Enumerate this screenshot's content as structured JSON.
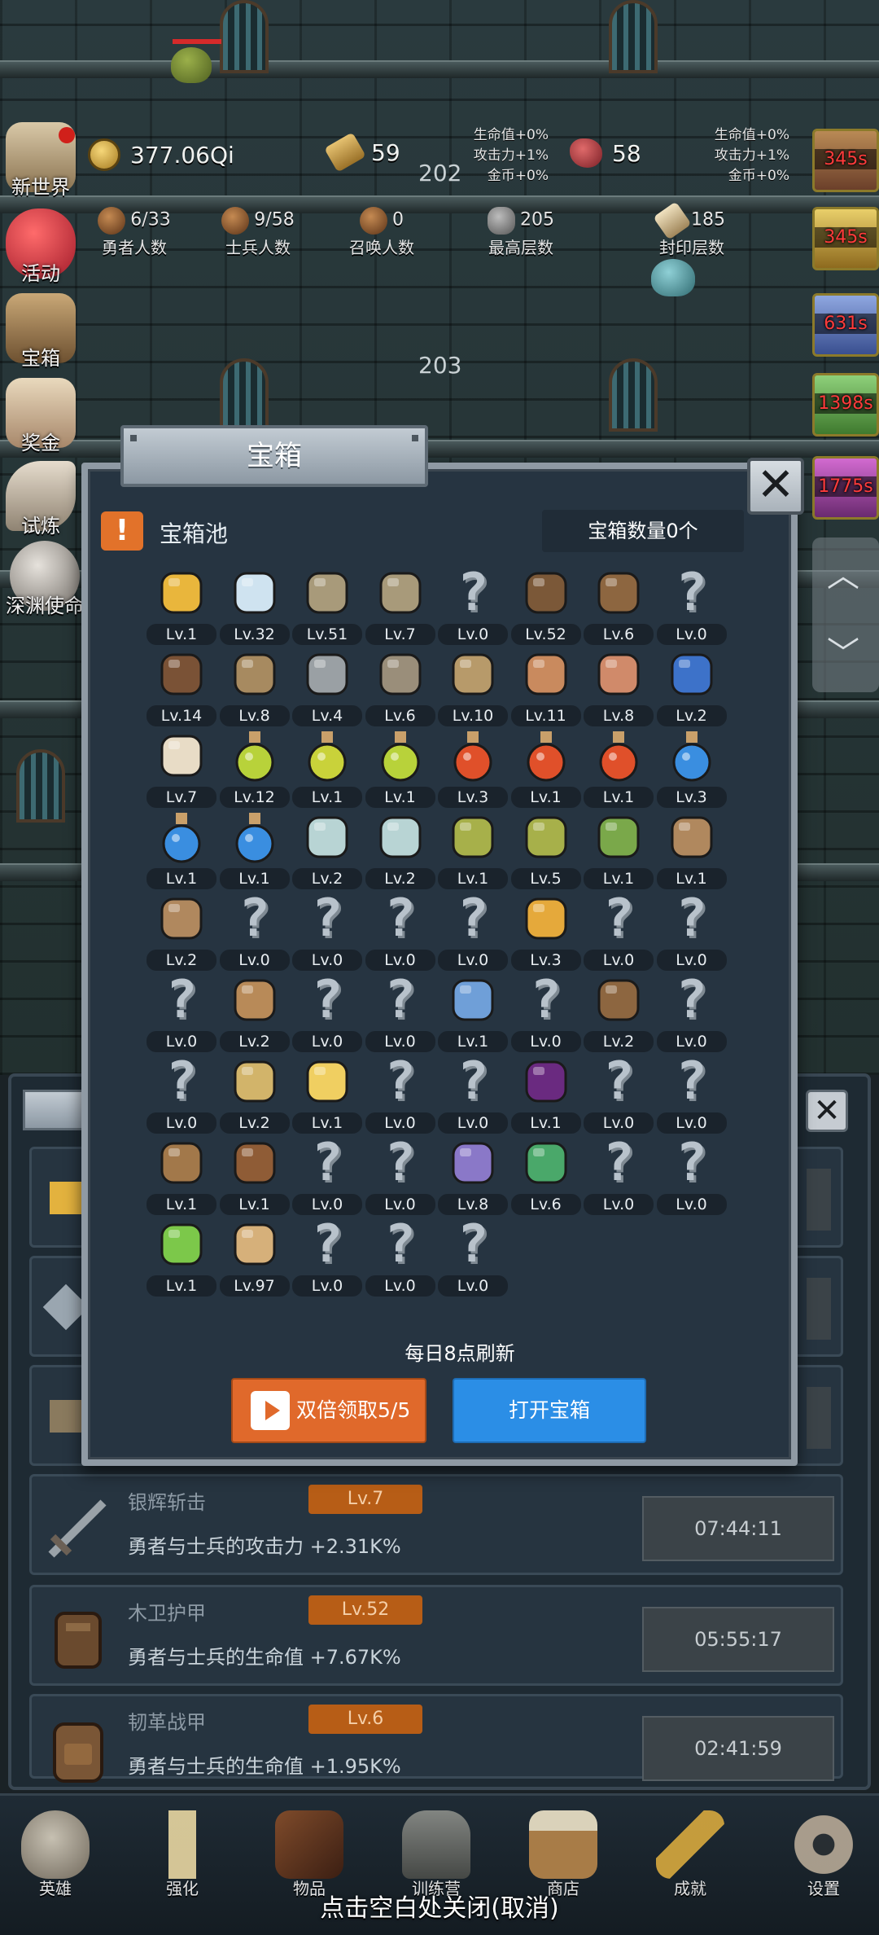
{
  "hud": {
    "gold": "377.06Qi",
    "scrolls": "59",
    "gems": "58",
    "bonus_left": [
      "生命值+0%",
      "攻击力+1%",
      "金币+0%"
    ],
    "bonus_right": [
      "生命值+0%",
      "攻击力+1%",
      "金币+0%"
    ],
    "floor_a": "202",
    "floor_b": "203",
    "stats": [
      {
        "value": "6/33",
        "label": "勇者人数"
      },
      {
        "value": "9/58",
        "label": "士兵人数"
      },
      {
        "value": "0",
        "label": "召唤人数"
      },
      {
        "value": "205",
        "label": "最高层数"
      },
      {
        "value": "185",
        "label": "封印层数"
      }
    ]
  },
  "side_menu": [
    {
      "label": "新世界",
      "icon": "map-icon"
    },
    {
      "label": "活动",
      "icon": "heart-icon"
    },
    {
      "label": "宝箱",
      "icon": "chest-icon"
    },
    {
      "label": "奖金",
      "icon": "envelope-icon"
    },
    {
      "label": "试炼",
      "icon": "wing-icon"
    },
    {
      "label": "深渊使命",
      "icon": "orb-icon"
    }
  ],
  "timers": [
    "345s",
    "345s",
    "631s",
    "1398s",
    "1775s"
  ],
  "modal": {
    "title": "宝箱",
    "pool_title": "宝箱池",
    "chest_count": "宝箱数量0个",
    "refresh_text": "每日8点刷新",
    "double_button": "双倍领取5/5",
    "open_button": "打开宝箱",
    "items": [
      {
        "icon": "crown-icon",
        "level": "Lv.1"
      },
      {
        "icon": "diamond-icon",
        "level": "Lv.32"
      },
      {
        "icon": "sword-icon",
        "level": "Lv.51"
      },
      {
        "icon": "sword-icon",
        "level": "Lv.7"
      },
      {
        "icon": "unknown-icon",
        "level": "Lv.0"
      },
      {
        "icon": "armor-icon",
        "level": "Lv.52"
      },
      {
        "icon": "backpack-icon",
        "level": "Lv.6"
      },
      {
        "icon": "unknown-icon",
        "level": "Lv.0"
      },
      {
        "icon": "helmet-icon",
        "level": "Lv.14"
      },
      {
        "icon": "dagger-icon",
        "level": "Lv.8"
      },
      {
        "icon": "knight-helmet-icon",
        "level": "Lv.4"
      },
      {
        "icon": "hammer-icon",
        "level": "Lv.6"
      },
      {
        "icon": "great-helm-icon",
        "level": "Lv.10"
      },
      {
        "icon": "ham-icon",
        "level": "Lv.11"
      },
      {
        "icon": "steak-icon",
        "level": "Lv.8"
      },
      {
        "icon": "pouch-icon",
        "level": "Lv.2"
      },
      {
        "icon": "flour-icon",
        "level": "Lv.7"
      },
      {
        "icon": "potion-icon",
        "level": "Lv.12"
      },
      {
        "icon": "potion-icon",
        "level": "Lv.1"
      },
      {
        "icon": "potion-icon",
        "level": "Lv.1"
      },
      {
        "icon": "potion-icon",
        "level": "Lv.3"
      },
      {
        "icon": "potion-icon",
        "level": "Lv.1"
      },
      {
        "icon": "potion-icon",
        "level": "Lv.1"
      },
      {
        "icon": "potion-icon",
        "level": "Lv.3"
      },
      {
        "icon": "potion-icon",
        "level": "Lv.1"
      },
      {
        "icon": "potion-icon",
        "level": "Lv.1"
      },
      {
        "icon": "vial-icon",
        "level": "Lv.2"
      },
      {
        "icon": "vial-icon",
        "level": "Lv.2"
      },
      {
        "icon": "bottle-icon",
        "level": "Lv.1"
      },
      {
        "icon": "bottle-icon",
        "level": "Lv.5"
      },
      {
        "icon": "winged-boot-icon",
        "level": "Lv.1"
      },
      {
        "icon": "boot-icon",
        "level": "Lv.1"
      },
      {
        "icon": "boot-icon",
        "level": "Lv.2"
      },
      {
        "icon": "unknown-icon",
        "level": "Lv.0"
      },
      {
        "icon": "unknown-icon",
        "level": "Lv.0"
      },
      {
        "icon": "unknown-icon",
        "level": "Lv.0"
      },
      {
        "icon": "unknown-icon",
        "level": "Lv.0"
      },
      {
        "icon": "torch-icon",
        "level": "Lv.3"
      },
      {
        "icon": "unknown-icon",
        "level": "Lv.0"
      },
      {
        "icon": "unknown-icon",
        "level": "Lv.0"
      },
      {
        "icon": "unknown-icon",
        "level": "Lv.0"
      },
      {
        "icon": "staff-icon",
        "level": "Lv.2"
      },
      {
        "icon": "unknown-icon",
        "level": "Lv.0"
      },
      {
        "icon": "unknown-icon",
        "level": "Lv.0"
      },
      {
        "icon": "scepter-icon",
        "level": "Lv.1"
      },
      {
        "icon": "unknown-icon",
        "level": "Lv.0"
      },
      {
        "icon": "backpack-icon",
        "level": "Lv.2"
      },
      {
        "icon": "unknown-icon",
        "level": "Lv.0"
      },
      {
        "icon": "unknown-icon",
        "level": "Lv.0"
      },
      {
        "icon": "club-icon",
        "level": "Lv.2"
      },
      {
        "icon": "cheese-icon",
        "level": "Lv.1"
      },
      {
        "icon": "unknown-icon",
        "level": "Lv.0"
      },
      {
        "icon": "unknown-icon",
        "level": "Lv.0"
      },
      {
        "icon": "crystal-icon",
        "level": "Lv.1"
      },
      {
        "icon": "unknown-icon",
        "level": "Lv.0"
      },
      {
        "icon": "unknown-icon",
        "level": "Lv.0"
      },
      {
        "icon": "bow-icon",
        "level": "Lv.1"
      },
      {
        "icon": "quiver-icon",
        "level": "Lv.1"
      },
      {
        "icon": "unknown-icon",
        "level": "Lv.0"
      },
      {
        "icon": "unknown-icon",
        "level": "Lv.0"
      },
      {
        "icon": "tentacle-icon",
        "level": "Lv.8"
      },
      {
        "icon": "emblem-icon",
        "level": "Lv.6"
      },
      {
        "icon": "unknown-icon",
        "level": "Lv.0"
      },
      {
        "icon": "unknown-icon",
        "level": "Lv.0"
      },
      {
        "icon": "wand-icon",
        "level": "Lv.1"
      },
      {
        "icon": "beer-icon",
        "level": "Lv.97"
      },
      {
        "icon": "unknown-icon",
        "level": "Lv.0"
      },
      {
        "icon": "unknown-icon",
        "level": "Lv.0"
      },
      {
        "icon": "unknown-icon",
        "level": "Lv.0"
      }
    ]
  },
  "underlying_list": [
    {
      "name": "银辉斩击",
      "level": "Lv.7",
      "desc": "勇者与士兵的攻击力 +2.31K%",
      "timer": "07:44:11",
      "icon": "sword-icon"
    },
    {
      "name": "木卫护甲",
      "level": "Lv.52",
      "desc": "勇者与士兵的生命值 +7.67K%",
      "timer": "05:55:17",
      "icon": "armor-icon"
    },
    {
      "name": "韧革战甲",
      "level": "Lv.6",
      "desc": "勇者与士兵的生命值 +1.95K%",
      "timer": "02:41:59",
      "icon": "backpack-icon"
    }
  ],
  "bottom_nav": [
    {
      "label": "英雄",
      "icon": "skull-icon"
    },
    {
      "label": "强化",
      "icon": "candle-icon"
    },
    {
      "label": "物品",
      "icon": "book-icon"
    },
    {
      "label": "训练营",
      "icon": "lantern-icon"
    },
    {
      "label": "商店",
      "icon": "beer-icon"
    },
    {
      "label": "成就",
      "icon": "key-icon"
    },
    {
      "label": "设置",
      "icon": "gear-icon"
    }
  ],
  "close_hint": "点击空白处关闭(取消)",
  "colors": {
    "accent_orange": "#e0692b",
    "accent_blue": "#2b8ee6",
    "timer_red": "#ff3b3b",
    "panel_bg": "#263441"
  }
}
